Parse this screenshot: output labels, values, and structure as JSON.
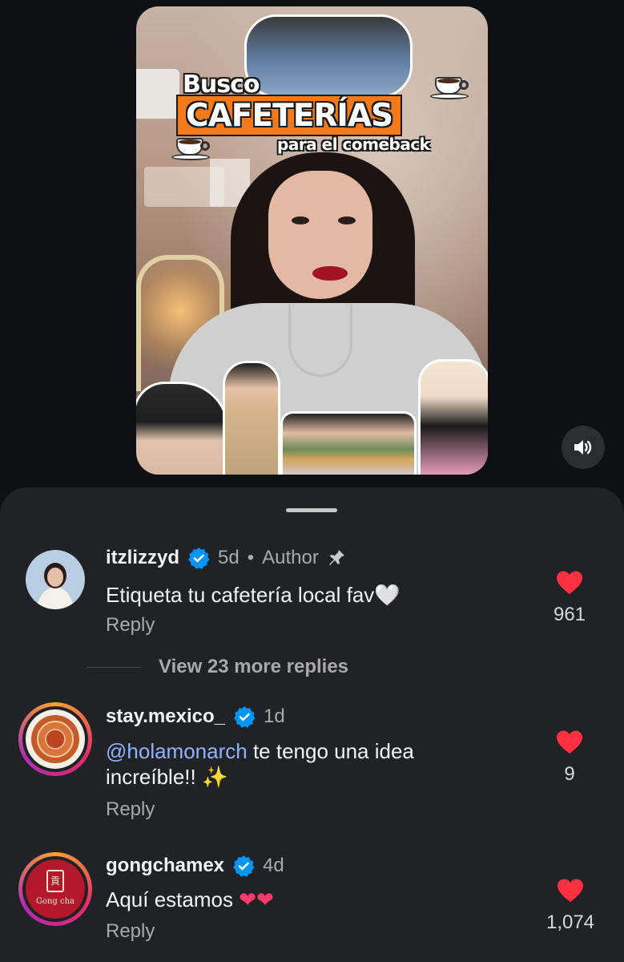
{
  "video": {
    "title_line1": "Busco",
    "title_line2": "CAFETERÍAS",
    "title_line3": "para el comeback",
    "volume_icon": "speaker-icon"
  },
  "comments": [
    {
      "username": "itzlizzyd",
      "verified": true,
      "age": "5d",
      "separator": "•",
      "role": "Author",
      "pinned": true,
      "text": "Etiqueta tu cafetería local fav🤍",
      "reply_label": "Reply",
      "likes": "961"
    },
    {
      "username": "stay.mexico_",
      "verified": true,
      "age": "1d",
      "mention": "@holamonarch",
      "text": " te tengo una idea increíble!! ✨",
      "reply_label": "Reply",
      "likes": "9"
    },
    {
      "username": "gongchamex",
      "verified": true,
      "age": "4d",
      "text": "Aquí estamos ",
      "hearts": "❤❤",
      "reply_label": "Reply",
      "likes": "1,074",
      "avatar_text": "Gong cha"
    }
  ],
  "view_more_replies": "View 23 more replies",
  "colors": {
    "background": "#0e1013",
    "sheet": "#212226",
    "like_red": "#ff3040",
    "verified_blue": "#0095f6",
    "mention": "#8fb3ff"
  }
}
